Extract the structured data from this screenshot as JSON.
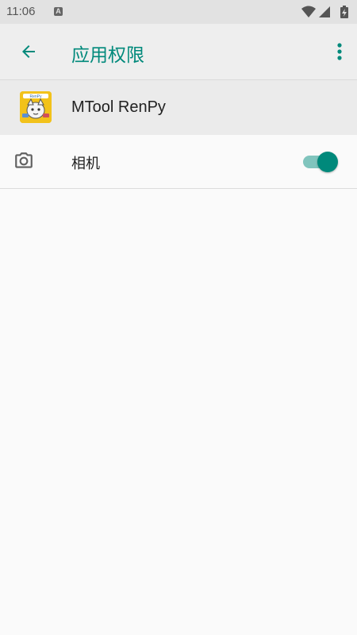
{
  "status_bar": {
    "time": "11:06",
    "notification_glyph": "A",
    "icons": [
      "wifi-icon",
      "cell-signal-icon",
      "battery-charging-icon"
    ]
  },
  "toolbar": {
    "back_icon": "arrow-back-icon",
    "title": "应用权限",
    "menu_icon": "more-vert-icon"
  },
  "app": {
    "name": "MTool RenPy",
    "icon": "mtool-renpy-app-icon"
  },
  "permissions": [
    {
      "icon": "camera-icon",
      "label": "相机",
      "enabled": true
    }
  ],
  "colors": {
    "accent": "#00897b",
    "toggle_track_on": "#80c4bd",
    "status_bar_bg": "#e2e2e2",
    "toolbar_bg": "#eeeeee",
    "app_row_bg": "#ebebeb",
    "page_bg": "#fafafa",
    "app_icon_bg": "#f2c21b"
  }
}
